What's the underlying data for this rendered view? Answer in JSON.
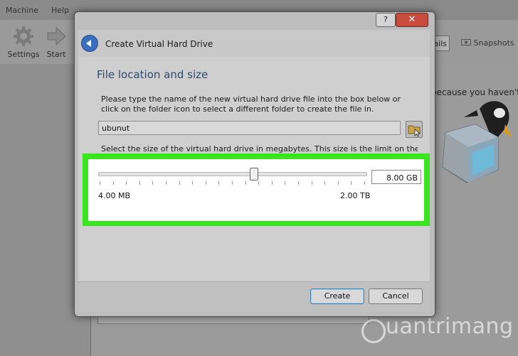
{
  "background": {
    "menu": [
      "Machine",
      "Help"
    ],
    "toolbar": {
      "settings_label": "Settings",
      "start_label": "Start"
    },
    "tabs": {
      "details_label": "tails",
      "snapshots_label": "Snapshots"
    },
    "welcome_text": "because you haven't"
  },
  "dialog": {
    "title": "Create Virtual Hard Drive",
    "help_label": "?",
    "close_label": "✕",
    "section_title": "File location and size",
    "location_description": "Please type the name of the new virtual hard drive file into the box below or click on the folder icon to select a different folder to create the file in.",
    "file_name_value": "ubunut",
    "size_description": "Select the size of the virtual hard drive in megabytes. This size is the limit on the amount of",
    "slider": {
      "min_label": "4.00 MB",
      "max_label": "2.00 TB",
      "value_fraction": 0.58
    },
    "size_value": "8.00 GB",
    "buttons": {
      "create_label": "Create",
      "cancel_label": "Cancel"
    }
  },
  "watermark": "uantrimang",
  "colors": {
    "highlight": "#39e51f",
    "close_button": "#c94b3c",
    "section_title": "#2e4a6f"
  }
}
